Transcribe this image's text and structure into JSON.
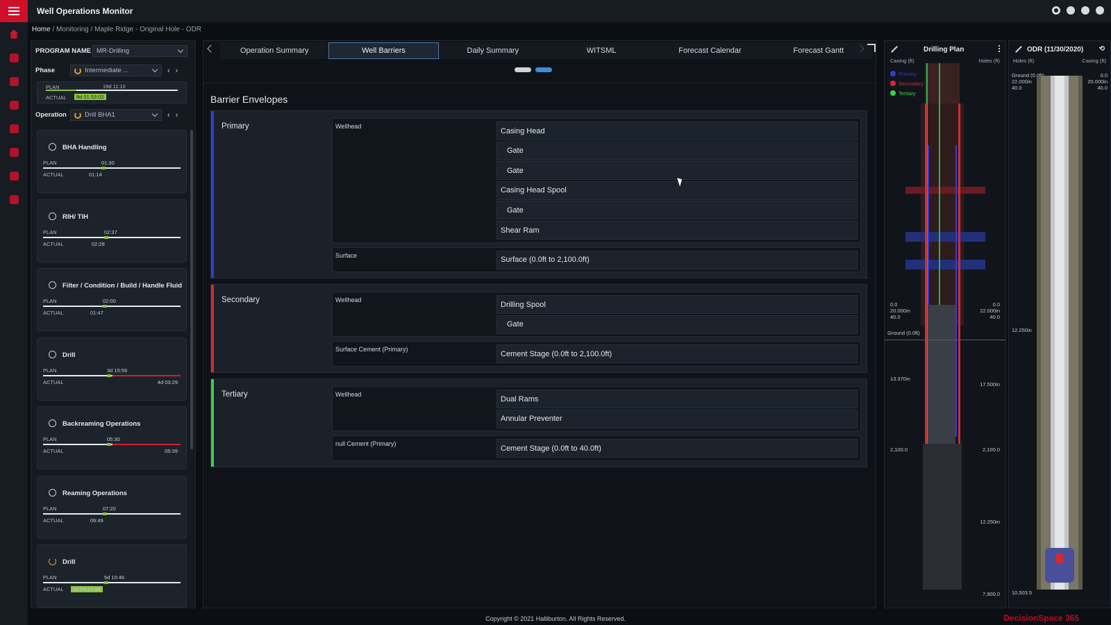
{
  "app": {
    "title": "Well Operations Monitor"
  },
  "breadcrumb": {
    "home": "Home",
    "sep1": " / ",
    "monitoring": "Monitoring",
    "sep2": " / ",
    "current": "Maple Ridge - Original Hole - ODR"
  },
  "left": {
    "program_label": "PROGRAM NAME",
    "program_value": "MR-Drilling",
    "phase_label": "Phase",
    "phase_value": "Intermediate ...",
    "phase_plan_label": "PLAN",
    "phase_plan_value": "19d 11:10",
    "phase_actual_label": "ACTUAL",
    "phase_actual_value": "8d 01:53:02",
    "operation_label": "Operation",
    "operation_value": "Drill BHA1",
    "ops": [
      {
        "name": "BHA Handling",
        "plan": "01:30",
        "actual": "01:14",
        "pct": 0.46,
        "over": false,
        "status": "done"
      },
      {
        "name": "RIH/ TIH",
        "plan": "02:37",
        "actual": "02:28",
        "pct": 0.48,
        "over": false,
        "status": "done"
      },
      {
        "name": "Filter / Condition / Build / Handle Fluid",
        "plan": "02:00",
        "actual": "01:47",
        "pct": 0.47,
        "over": false,
        "status": "done"
      },
      {
        "name": "Drill",
        "plan": "3d 15:59",
        "actual": "4d 03:29",
        "pct": 0.5,
        "over": true,
        "status": "done"
      },
      {
        "name": "Backreaming Operations",
        "plan": "05:30",
        "actual": "05:39",
        "pct": 0.5,
        "over": true,
        "status": "done"
      },
      {
        "name": "Reaming Operations",
        "plan": "07:20",
        "actual": "06:49",
        "pct": 0.47,
        "over": false,
        "status": "done"
      },
      {
        "name": "Drill",
        "plan": "5d 10:46",
        "actual": "1d 04:27:34",
        "pct": 0.48,
        "over": false,
        "status": "running"
      }
    ]
  },
  "tabs": [
    "Operation Summary",
    "Well Barriers",
    "Daily Summary",
    "WITSML",
    "Forecast Calendar",
    "Forecast Gantt"
  ],
  "active_tab": "Well Barriers",
  "barrier": {
    "title": "Barrier Envelopes",
    "envelopes": [
      {
        "name": "Primary",
        "color": "#2f3fd0",
        "groups": [
          {
            "name": "Wellhead",
            "items": [
              {
                "label": "Casing Head",
                "sub": false
              },
              {
                "label": "Gate",
                "sub": true
              },
              {
                "label": "Gate",
                "sub": true
              },
              {
                "label": "Casing Head Spool",
                "sub": false
              },
              {
                "label": "Gate",
                "sub": true
              },
              {
                "label": "Shear Ram",
                "sub": false
              }
            ]
          },
          {
            "name": "Surface",
            "items": [
              {
                "label": "Surface (0.0ft to 2,100.0ft)",
                "sub": false
              }
            ]
          }
        ]
      },
      {
        "name": "Secondary",
        "color": "#d12a32",
        "groups": [
          {
            "name": "Wellhead",
            "items": [
              {
                "label": "Drilling Spool",
                "sub": false
              },
              {
                "label": "Gate",
                "sub": true
              }
            ]
          },
          {
            "name": "Surface Cement (Primary)",
            "items": [
              {
                "label": "Cement Stage (0.0ft to 2,100.0ft)",
                "sub": false
              }
            ]
          }
        ]
      },
      {
        "name": "Tertiary",
        "color": "#3ccf4a",
        "groups": [
          {
            "name": "Wellhead",
            "items": [
              {
                "label": "Dual Rams",
                "sub": false
              },
              {
                "label": "Annular Preventer",
                "sub": false
              }
            ]
          },
          {
            "name": "null Cement (Primary)",
            "items": [
              {
                "label": "Cement Stage (0.0ft to 40.0ft)",
                "sub": false
              }
            ]
          }
        ]
      }
    ]
  },
  "drilling_plan": {
    "title": "Drilling Plan",
    "casing_label": "Casing (ft)",
    "holes_label": "Holes (ft)",
    "legend": [
      {
        "label": "Primary",
        "color": "#2f3fd0"
      },
      {
        "label": "Secondary",
        "color": "#d12a32"
      },
      {
        "label": "Tertiary",
        "color": "#3ccf4a"
      }
    ],
    "depths_left": [
      "0.0",
      "20.000in",
      "40.0",
      "Ground (0.0ft)",
      "13.370in",
      "2,100.0"
    ],
    "depths_right": [
      "0.0",
      "22.000in",
      "40.0",
      "17.500in",
      "2,100.0",
      "12.250in",
      "7,900.0"
    ]
  },
  "odr": {
    "title": "ODR (11/30/2020)",
    "holes_label": "Holes (ft)",
    "casing_label": "Casing (ft)",
    "top_left": "Ground (0.0ft)",
    "top_left2": "22.000in",
    "top_left3": "40.0",
    "top_right": "0.0",
    "top_right2": "20.000in",
    "top_right3": "40.0",
    "mid": "12.250in",
    "bottom": "10,503.5"
  },
  "footer": {
    "copyright": "Copyright © 2021 Halliburton. All Rights Reserved.",
    "brand": "DecisionSpace 365"
  }
}
